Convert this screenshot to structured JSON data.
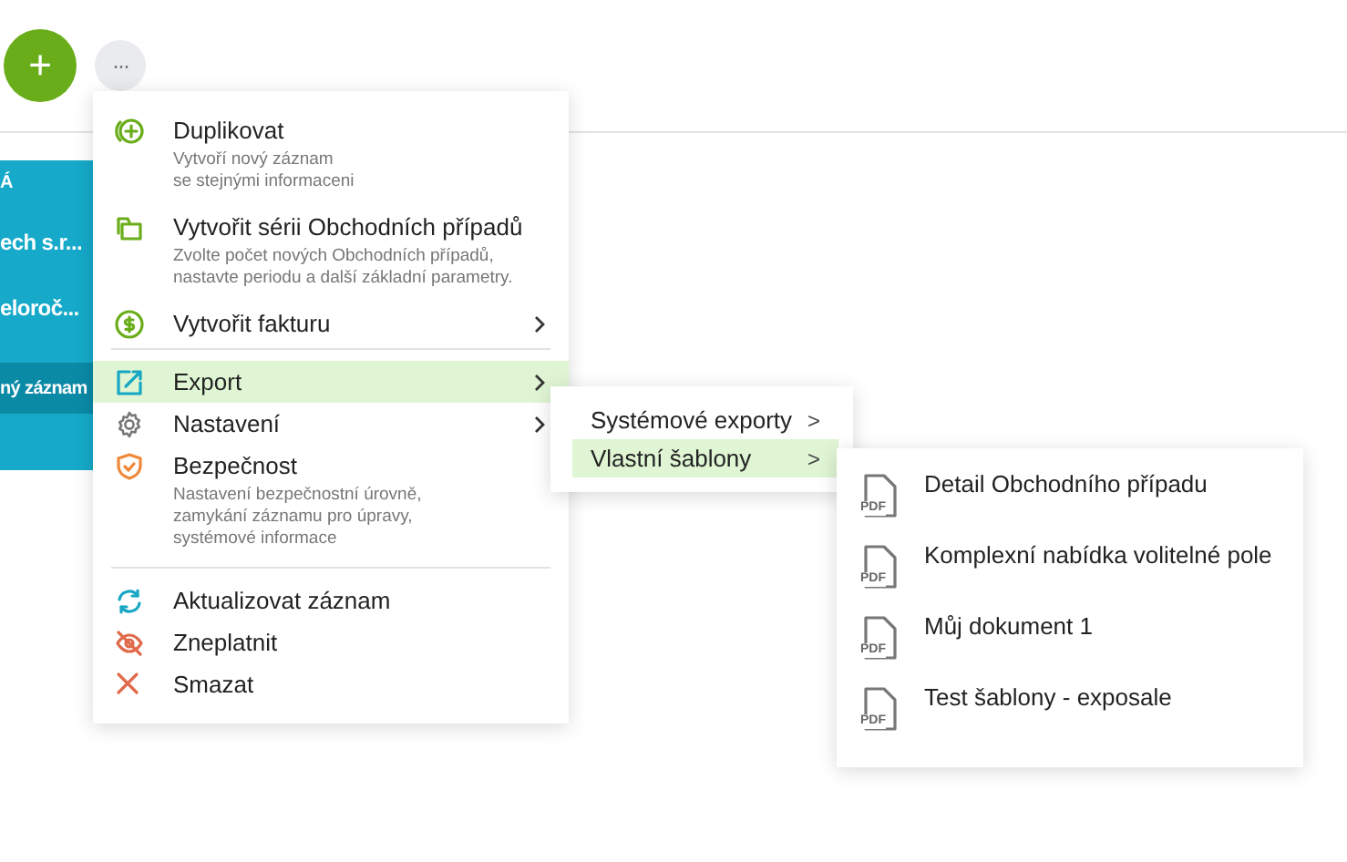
{
  "toolbar": {
    "add_button": "+",
    "more_button": "···"
  },
  "record_card": {
    "lines": [
      {
        "text": "Á",
        "kind": "label"
      },
      {
        "text": "ech s.r...",
        "kind": "title"
      },
      {
        "text": "eloroč...",
        "kind": "title"
      },
      {
        "text": "ný záznam",
        "kind": "band"
      }
    ]
  },
  "menu": {
    "sections": [
      [
        {
          "label": "Duplikovat",
          "description": "Vytvoří nový záznam\nse stejnými informaceni",
          "has_submenu": false,
          "selected": false
        },
        {
          "label": "Vytvořit sérii Obchodních případů",
          "description": "Zvolte počet nových Obchodních případů,\nnastavte periodu a další základní parametry.",
          "has_submenu": false,
          "selected": false
        },
        {
          "label": "Vytvořit fakturu",
          "has_submenu": true,
          "selected": false
        }
      ],
      [
        {
          "label": "Export",
          "has_submenu": true,
          "selected": true
        },
        {
          "label": "Nastavení",
          "has_submenu": true,
          "selected": false
        },
        {
          "label": "Bezpečnost",
          "description": "Nastavení bezpečnostní úrovně,\nzamykání záznamu pro úpravy,\nsystémové informace",
          "has_submenu": false,
          "selected": false
        }
      ],
      [
        {
          "label": "Aktualizovat záznam",
          "has_submenu": false,
          "selected": false
        },
        {
          "label": "Zneplatnit",
          "has_submenu": false,
          "selected": false
        },
        {
          "label": "Smazat",
          "has_submenu": false,
          "selected": false
        }
      ]
    ]
  },
  "export_submenu": {
    "items": [
      {
        "label": "Systémové exporty",
        "selected": false,
        "chevron": ">"
      },
      {
        "label": "Vlastní šablony",
        "selected": true,
        "chevron": ">"
      }
    ]
  },
  "templates_submenu": {
    "items": [
      {
        "label": "Detail Obchodního případu",
        "file_type": "PDF"
      },
      {
        "label": "Komplexní nabídka volitelné pole",
        "file_type": "PDF"
      },
      {
        "label": "Můj dokument 1",
        "file_type": "PDF"
      },
      {
        "label": "Test šablony - exposale",
        "file_type": "PDF"
      }
    ]
  }
}
